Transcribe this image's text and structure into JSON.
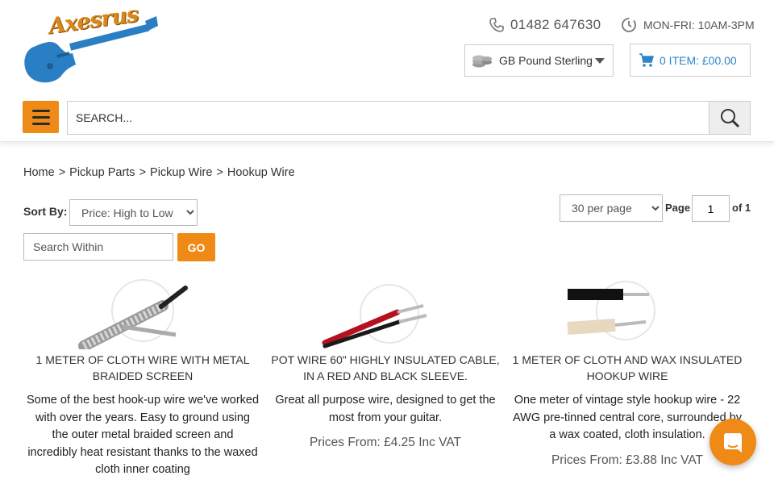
{
  "header": {
    "logo_text": "Axesrus",
    "phone": "01482 647630",
    "hours": "MON-FRI: 10AM-3PM",
    "currency": "GB Pound Sterling",
    "cart": "0 ITEM: £00.00",
    "search_placeholder": "SEARCH..."
  },
  "breadcrumb": {
    "items": [
      "Home",
      "Pickup Parts",
      "Pickup Wire",
      "Hookup Wire"
    ],
    "separator": ">"
  },
  "toolbar": {
    "sort_label": "Sort By:",
    "sort_value": "Price: High to Low",
    "per_page": "30 per page",
    "page_label": "Page",
    "page_value": "1",
    "page_of": "of 1",
    "search_within_placeholder": "Search Within",
    "go_label": "GO"
  },
  "products": [
    {
      "title": "1 METER OF CLOTH WIRE WITH METAL BRAIDED SCREEN",
      "desc": "Some of the best hook-up wire we've worked with over the years. Easy to ground using the outer metal braided screen and incredibly heat resistant thanks to the waxed cloth inner coating",
      "price": ""
    },
    {
      "title": "POT WIRE 60\" HIGHLY INSULATED CABLE, IN A RED AND BLACK SLEEVE.",
      "desc": "Great all purpose wire, designed to get the most from your guitar.",
      "price": "Prices From: £4.25 Inc VAT"
    },
    {
      "title": "1 METER OF CLOTH AND WAX INSULATED HOOKUP WIRE",
      "desc": "One meter of vintage style hookup wire - 22 AWG pre-tinned central core, surrounded by a wax coated, cloth insulation.",
      "price": "Prices From: £3.88 Inc VAT"
    }
  ],
  "colors": {
    "accent": "#ef8a17",
    "link_blue": "#2a86c8"
  },
  "icons": {
    "phone": "phone-icon",
    "clock": "clock-icon",
    "coins": "coins-icon",
    "cart": "cart-icon",
    "menu": "hamburger-icon",
    "search": "magnifier-icon",
    "chat": "chat-icon"
  }
}
